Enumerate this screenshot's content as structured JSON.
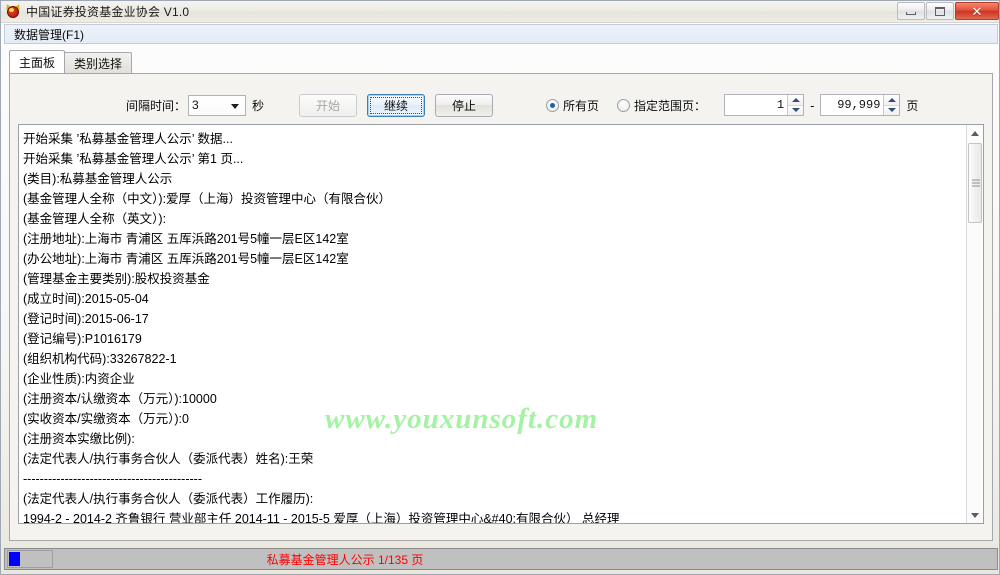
{
  "window": {
    "title": "中国证券投资基金业协会 V1.0",
    "app_icon": "devil-mascot-icon",
    "buttons": {
      "minimize": "minimize-icon",
      "maximize": "maximize-icon",
      "close": "✕"
    }
  },
  "menubar": {
    "items": [
      {
        "label": "数据管理(F1)"
      }
    ]
  },
  "tabs": [
    {
      "label": "主面板",
      "active": true
    },
    {
      "label": "类别选择",
      "active": false
    }
  ],
  "toolbar": {
    "interval_label": "间隔时间：",
    "interval_value": "3",
    "interval_unit": "秒",
    "start_button": "开始",
    "continue_button": "继续",
    "stop_button": "停止",
    "radio_all_pages": "所有页",
    "radio_range_pages": "指定范围页：",
    "range_from": "1",
    "range_separator": "-",
    "range_to": "99,999",
    "page_unit": "页"
  },
  "log": {
    "lines": [
      "开始采集 ’私募基金管理人公示’ 数据...",
      "开始采集 ’私募基金管理人公示’ 第1 页...",
      "(类目):私募基金管理人公示",
      "(基金管理人全称（中文）):爱厚（上海）投资管理中心（有限合伙）",
      "(基金管理人全称（英文）):",
      "(注册地址):上海市 青浦区 五厍浜路201号5幢一层E区142室",
      "(办公地址):上海市 青浦区 五厍浜路201号5幢一层E区142室",
      "(管理基金主要类别):股权投资基金",
      "(成立时间):2015-05-04",
      "(登记时间):2015-06-17",
      "(登记编号):P1016179",
      "(组织机构代码):33267822-1",
      "(企业性质):内资企业",
      "(注册资本/认缴资本（万元）):10000",
      "(实收资本/实缴资本（万元）):0",
      "(注册资本实缴比例):",
      "(法定代表人/执行事务合伙人（委派代表）姓名):王荣",
      "-------------------------------------------",
      "(法定代表人/执行事务合伙人（委派代表）工作履历):",
      "1994-2 - 2014-2 齐鲁银行 营业部主任 2014-11 - 2015-5 爱厚（上海）投资管理中心&#40;有限合伙） 总经理"
    ],
    "watermark": "www.youxunsoft.com"
  },
  "scrollbar": {
    "up_icon": "scroll-up-arrow-icon",
    "down_icon": "scroll-down-arrow-icon"
  },
  "statusbar": {
    "progress_text": "",
    "status_text": "私募基金管理人公示 1/135 页"
  },
  "colors": {
    "status_text": "#ff0000",
    "progress_fill": "#0000ff",
    "watermark": "#a4f2a4",
    "focus_border": "#3c7fb1",
    "radio_dot": "#1d5fa8"
  }
}
